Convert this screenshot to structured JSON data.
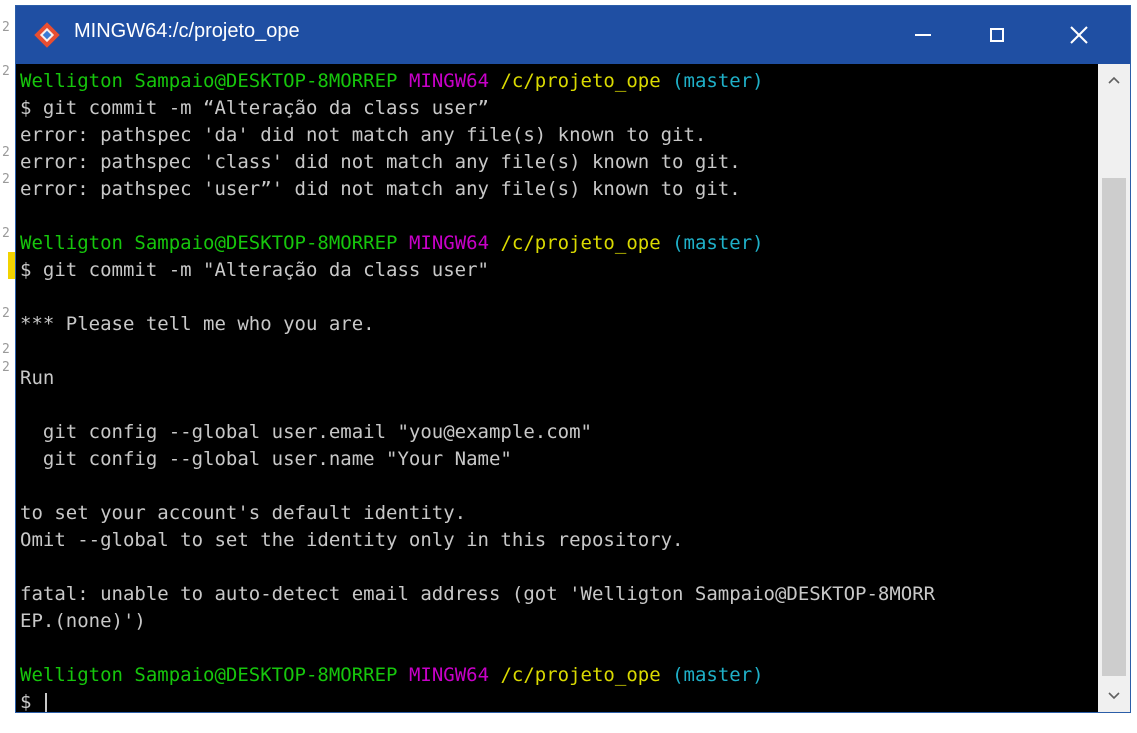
{
  "window": {
    "title": "MINGW64:/c/projeto_ope",
    "icon": "git-bash-icon",
    "controls": [
      "minimize-icon",
      "maximize-icon",
      "close-icon"
    ]
  },
  "colors": {
    "titlebar": "#1f4fa3",
    "terminal_bg": "#000000",
    "text": "#c8c8c8",
    "user_host": "#16c60c",
    "env": "#c800c8",
    "path": "#dada00",
    "branch": "#1fb0c8"
  },
  "gutter": {
    "marks": [
      "2",
      "2",
      "2",
      "2",
      "2",
      "2",
      "2",
      "2"
    ]
  },
  "prompt": {
    "user_host": "Welligton Sampaio@DESKTOP-8MORREP",
    "env": "MINGW64",
    "path": "/c/projeto_ope",
    "branch": "(master)"
  },
  "terminal": {
    "cmd1": "$ git commit -m “Alteração da class user”",
    "err1": "error: pathspec 'da' did not match any file(s) known to git.",
    "err2": "error: pathspec 'class' did not match any file(s) known to git.",
    "err3": "error: pathspec 'user”' did not match any file(s) known to git.",
    "cmd2": "$ git commit -m \"Alteração da class user\"",
    "msg1": "*** Please tell me who you are.",
    "msg2": "Run",
    "msg3": "  git config --global user.email \"you@example.com\"",
    "msg4": "  git config --global user.name \"Your Name\"",
    "msg5": "to set your account's default identity.",
    "msg6": "Omit --global to set the identity only in this repository.",
    "fatal1": "fatal: unable to auto-detect email address (got 'Welligton Sampaio@DESKTOP-8MORR",
    "fatal2": "EP.(none)')",
    "prompt_symbol": "$ "
  },
  "scrollbar": {
    "up": "scroll-up-arrow-icon",
    "down": "scroll-down-arrow-icon"
  }
}
